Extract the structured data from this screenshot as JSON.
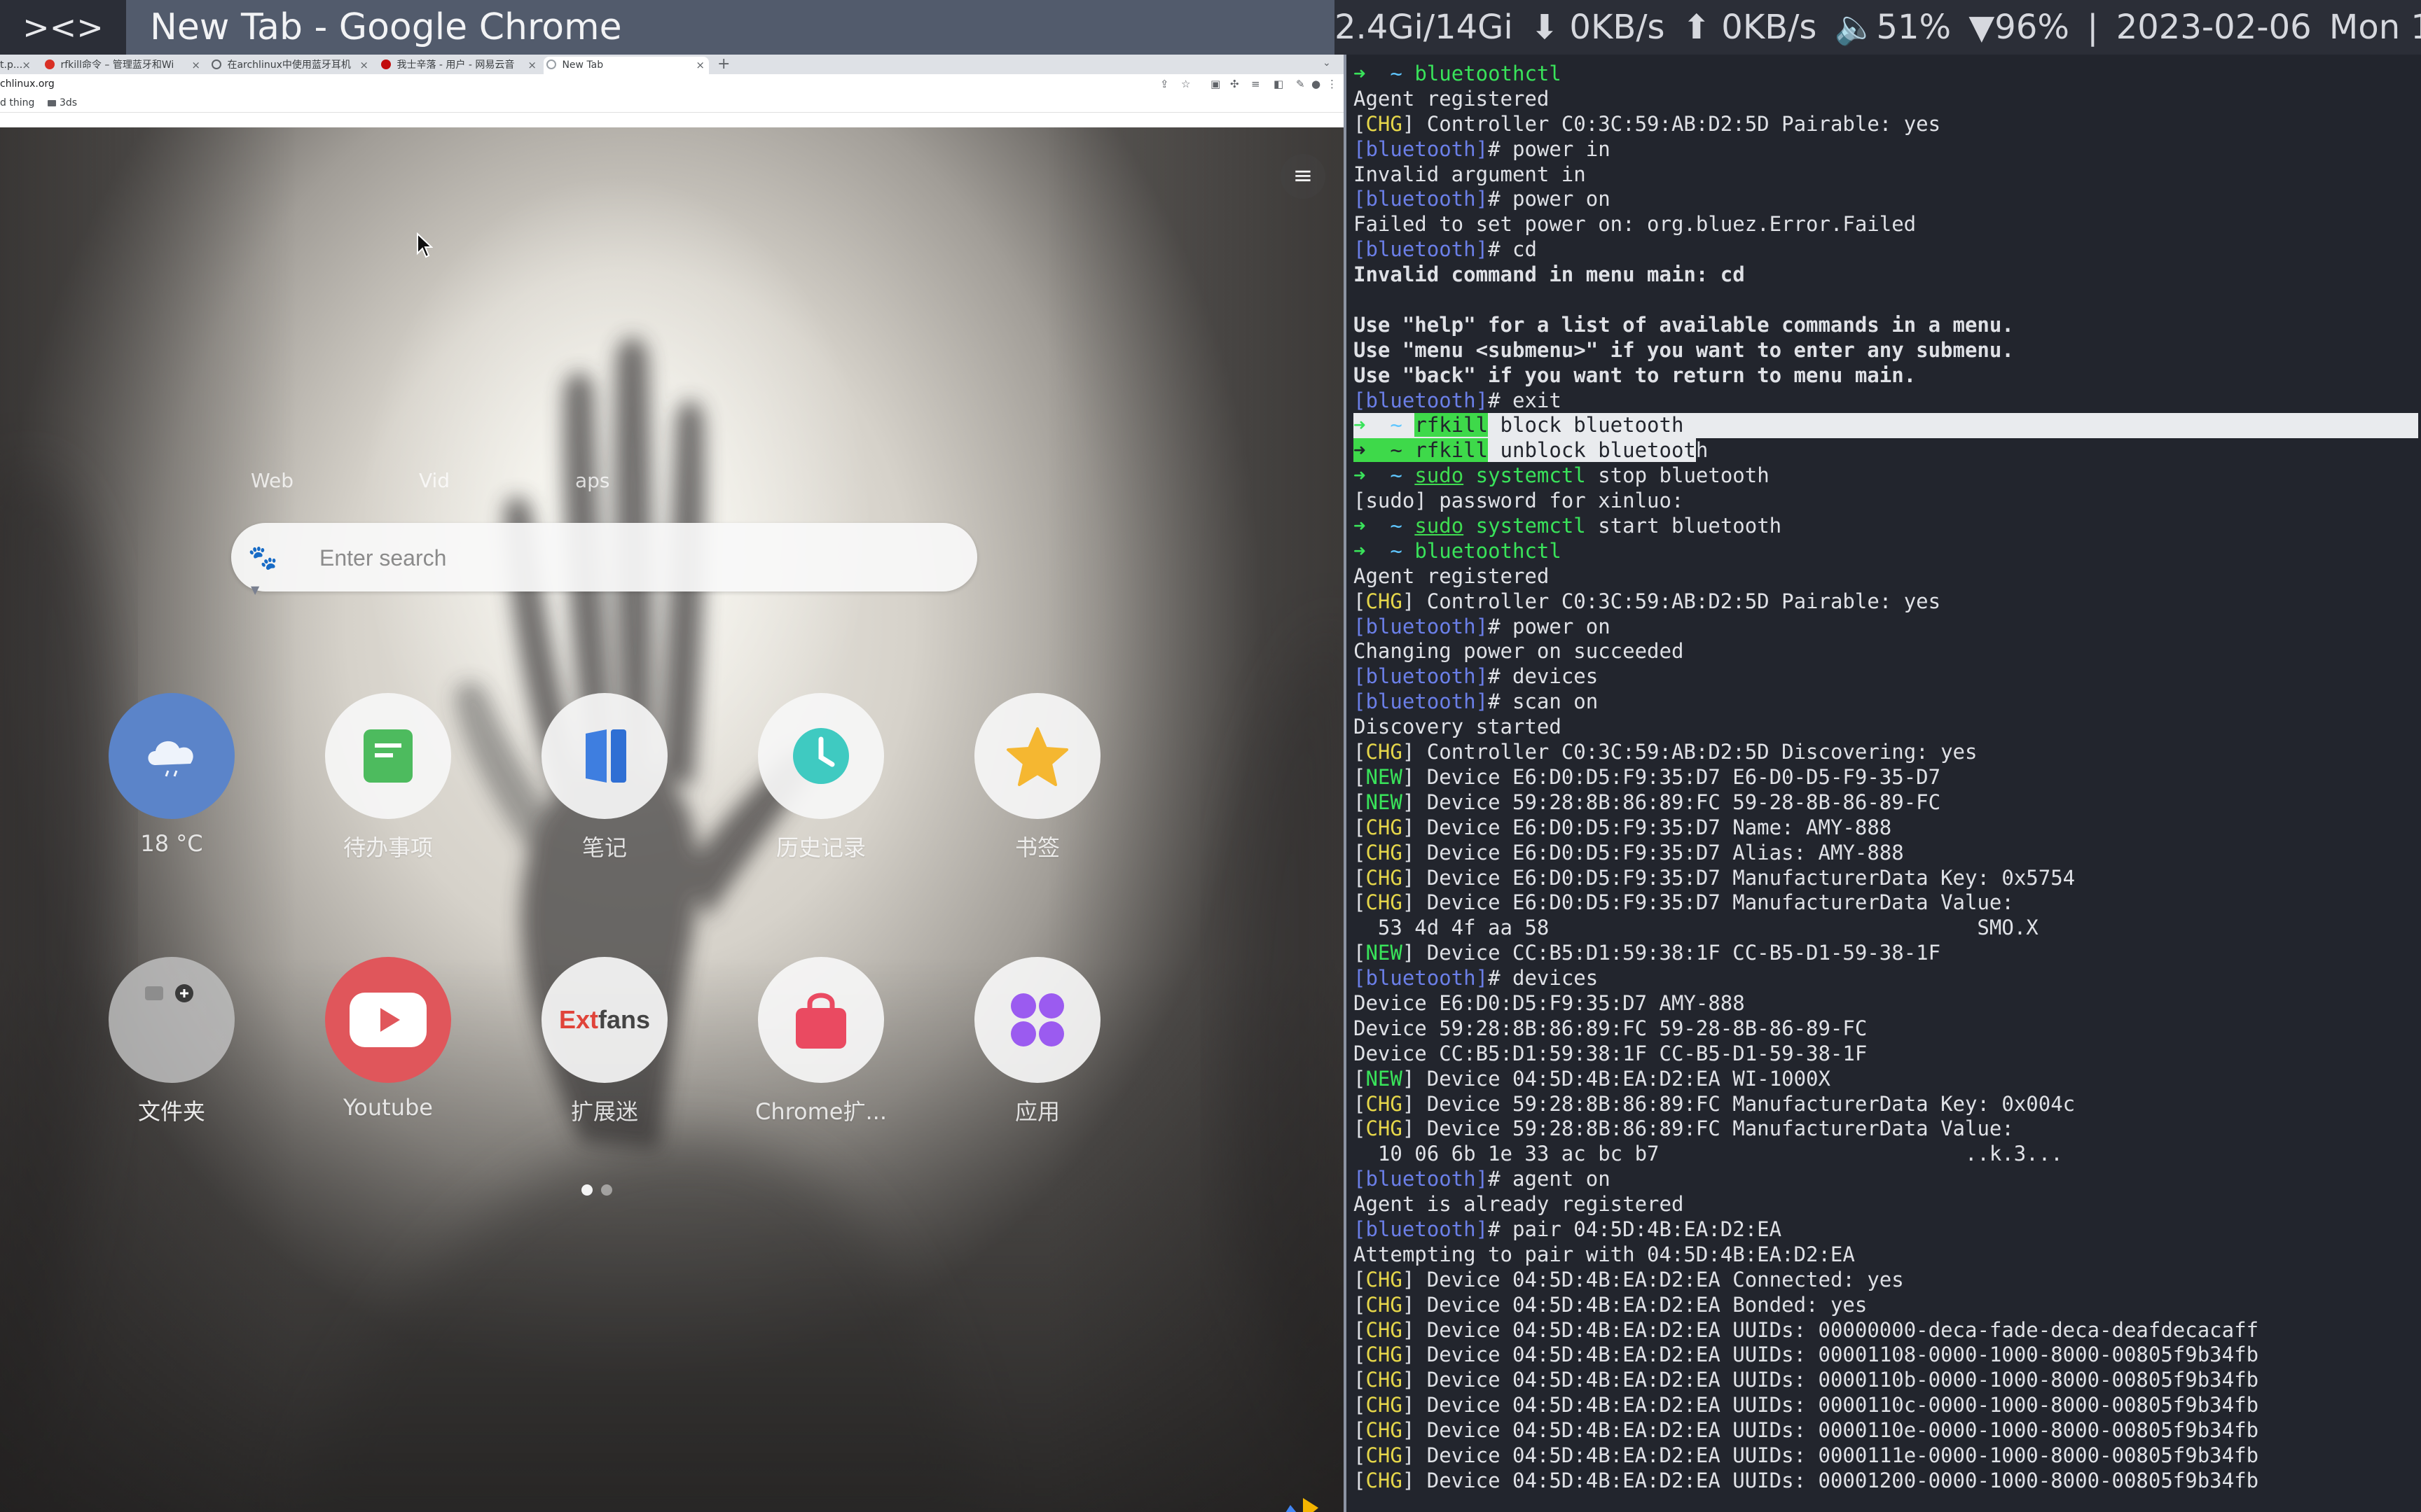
{
  "topbar": {
    "wm_logo": "><>",
    "window_title": "New Tab - Google Chrome",
    "memory": "2.4Gi/14Gi",
    "net_down": "⬇ 0KB/s",
    "net_up": "⬆ 0KB/s",
    "volume": "🔈51%",
    "battery": "▼96%",
    "separator": "|",
    "date": "2023-02-06",
    "day": "Mon 1"
  },
  "chrome": {
    "tabs": [
      {
        "label": "t.p...",
        "icon_color": "#5f6368"
      },
      {
        "label": "rfkill命令 – 管理蓝牙和Wi",
        "icon_color": "#d93025"
      },
      {
        "label": "在archlinux中使用蓝牙耳机",
        "icon_color": "#5f6368"
      },
      {
        "label": "我士辛落 - 用户 - 网易云音",
        "icon_color": "#c20c0c"
      },
      {
        "label": "New Tab",
        "icon_color": "#9aa0a6"
      }
    ],
    "url": "chlinux.org",
    "bookmarks": [
      "d thing",
      "3ds"
    ]
  },
  "ntp": {
    "search_tabs": [
      "Web",
      "Vid",
      "aps"
    ],
    "search_placeholder": "Enter search",
    "apps": [
      {
        "label": "18 °C",
        "icon": "cloud-rain-icon",
        "bg": "#5b84c9"
      },
      {
        "label": "待办事项",
        "icon": "note-icon",
        "bg": "#f3f3f3"
      },
      {
        "label": "笔记",
        "icon": "notebook-icon",
        "bg": "#f3f3f3"
      },
      {
        "label": "历史记录",
        "icon": "clock-icon",
        "bg": "#f3f3f3"
      },
      {
        "label": "书签",
        "icon": "star-icon",
        "bg": "#f3f3f3"
      },
      {
        "label": "文件夹",
        "icon": "folder-group-icon",
        "bg": "#bdbdbd"
      },
      {
        "label": "Youtube",
        "icon": "youtube-icon",
        "bg": "#e0565b"
      },
      {
        "label": "扩展迷",
        "icon": "extfans-icon",
        "bg": "#f3f3f3"
      },
      {
        "label": "Chrome扩...",
        "icon": "bag-icon",
        "bg": "#f3f3f3"
      },
      {
        "label": "应用",
        "icon": "apps-icon",
        "bg": "#f3f3f3"
      }
    ],
    "extfans_text": {
      "ext": "Ext",
      "fans": "fans"
    },
    "pager": {
      "pages": 2,
      "current": 1
    }
  },
  "terminal": {
    "lines": [
      [
        {
          "t": "➜ ",
          "c": "c-green"
        },
        {
          "t": " ~ ",
          "c": "c-cyan"
        },
        {
          "t": "bluetoothctl",
          "c": "c-green"
        }
      ],
      [
        {
          "t": "Agent registered"
        }
      ],
      [
        {
          "t": "["
        },
        {
          "t": "CHG",
          "c": "c-yellow"
        },
        {
          "t": "] Controller C0:3C:59:AB:D2:5D Pairable: yes"
        }
      ],
      [
        {
          "t": "[bluetooth]",
          "c": "c-blue"
        },
        {
          "t": "# power in"
        }
      ],
      [
        {
          "t": "Invalid argument in"
        }
      ],
      [
        {
          "t": "[bluetooth]",
          "c": "c-blue"
        },
        {
          "t": "# power on"
        }
      ],
      [
        {
          "t": "Failed to set power on: org.bluez.Error.Failed"
        }
      ],
      [
        {
          "t": "[bluetooth]",
          "c": "c-blue"
        },
        {
          "t": "# cd"
        }
      ],
      [
        {
          "t": "Invalid command in menu main: cd",
          "c": "c-bold"
        }
      ],
      [
        {
          "t": ""
        }
      ],
      [
        {
          "t": "Use \"help\" for a list of available commands in a menu.",
          "c": "c-bold"
        }
      ],
      [
        {
          "t": "Use \"menu <submenu>\" if you want to enter any submenu.",
          "c": "c-bold"
        }
      ],
      [
        {
          "t": "Use \"back\" if you want to return to menu main.",
          "c": "c-bold"
        }
      ],
      [
        {
          "t": "[bluetooth]",
          "c": "c-blue"
        },
        {
          "t": "# exit"
        }
      ],
      [
        {
          "t": "➜ ",
          "c": "c-green"
        },
        {
          "t": " ~ ",
          "c": "c-cyan"
        },
        {
          "t": "rfkill",
          "c": "hl-green"
        },
        {
          "t": " block bluetooth",
          "c": "hl-line"
        }
      ],
      [
        {
          "t": "➜ ",
          "c": "hl-green"
        },
        {
          "t": " ~ ",
          "c": "hl-green"
        },
        {
          "t": "rfkill",
          "c": "hl-green"
        },
        {
          "t": " unblock bluetoot",
          "c": "hl-line"
        },
        {
          "t": "h"
        }
      ],
      [
        {
          "t": "➜ ",
          "c": "c-green"
        },
        {
          "t": " ~ ",
          "c": "c-cyan"
        },
        {
          "t": "sudo",
          "c": "c-under"
        },
        {
          "t": " "
        },
        {
          "t": "systemctl",
          "c": "c-green"
        },
        {
          "t": " stop bluetooth"
        }
      ],
      [
        {
          "t": "[sudo] password for xinluo:"
        }
      ],
      [
        {
          "t": "➜ ",
          "c": "c-green"
        },
        {
          "t": " ~ ",
          "c": "c-cyan"
        },
        {
          "t": "sudo",
          "c": "c-under"
        },
        {
          "t": " "
        },
        {
          "t": "systemctl",
          "c": "c-green"
        },
        {
          "t": " start bluetooth"
        }
      ],
      [
        {
          "t": "➜ ",
          "c": "c-green"
        },
        {
          "t": " ~ ",
          "c": "c-cyan"
        },
        {
          "t": "bluetoothctl",
          "c": "c-green"
        }
      ],
      [
        {
          "t": "Agent registered"
        }
      ],
      [
        {
          "t": "["
        },
        {
          "t": "CHG",
          "c": "c-yellow"
        },
        {
          "t": "] Controller C0:3C:59:AB:D2:5D Pairable: yes"
        }
      ],
      [
        {
          "t": "[bluetooth]",
          "c": "c-blue"
        },
        {
          "t": "# power on"
        }
      ],
      [
        {
          "t": "Changing power on succeeded"
        }
      ],
      [
        {
          "t": "[bluetooth]",
          "c": "c-blue"
        },
        {
          "t": "# devices"
        }
      ],
      [
        {
          "t": "[bluetooth]",
          "c": "c-blue"
        },
        {
          "t": "# scan on"
        }
      ],
      [
        {
          "t": "Discovery started"
        }
      ],
      [
        {
          "t": "["
        },
        {
          "t": "CHG",
          "c": "c-yellow"
        },
        {
          "t": "] Controller C0:3C:59:AB:D2:5D Discovering: yes"
        }
      ],
      [
        {
          "t": "["
        },
        {
          "t": "NEW",
          "c": "c-green"
        },
        {
          "t": "] Device E6:D0:D5:F9:35:D7 E6-D0-D5-F9-35-D7"
        }
      ],
      [
        {
          "t": "["
        },
        {
          "t": "NEW",
          "c": "c-green"
        },
        {
          "t": "] Device 59:28:8B:86:89:FC 59-28-8B-86-89-FC"
        }
      ],
      [
        {
          "t": "["
        },
        {
          "t": "CHG",
          "c": "c-yellow"
        },
        {
          "t": "] Device E6:D0:D5:F9:35:D7 Name: AMY-888"
        }
      ],
      [
        {
          "t": "["
        },
        {
          "t": "CHG",
          "c": "c-yellow"
        },
        {
          "t": "] Device E6:D0:D5:F9:35:D7 Alias: AMY-888"
        }
      ],
      [
        {
          "t": "["
        },
        {
          "t": "CHG",
          "c": "c-yellow"
        },
        {
          "t": "] Device E6:D0:D5:F9:35:D7 ManufacturerData Key: 0x5754"
        }
      ],
      [
        {
          "t": "["
        },
        {
          "t": "CHG",
          "c": "c-yellow"
        },
        {
          "t": "] Device E6:D0:D5:F9:35:D7 ManufacturerData Value:"
        }
      ],
      [
        {
          "t": "  53 4d 4f aa 58                                   SMO.X"
        }
      ],
      [
        {
          "t": "["
        },
        {
          "t": "NEW",
          "c": "c-green"
        },
        {
          "t": "] Device CC:B5:D1:59:38:1F CC-B5-D1-59-38-1F"
        }
      ],
      [
        {
          "t": "[bluetooth]",
          "c": "c-blue"
        },
        {
          "t": "# devices"
        }
      ],
      [
        {
          "t": "Device E6:D0:D5:F9:35:D7 AMY-888"
        }
      ],
      [
        {
          "t": "Device 59:28:8B:86:89:FC 59-28-8B-86-89-FC"
        }
      ],
      [
        {
          "t": "Device CC:B5:D1:59:38:1F CC-B5-D1-59-38-1F"
        }
      ],
      [
        {
          "t": "["
        },
        {
          "t": "NEW",
          "c": "c-green"
        },
        {
          "t": "] Device 04:5D:4B:EA:D2:EA WI-1000X"
        }
      ],
      [
        {
          "t": "["
        },
        {
          "t": "CHG",
          "c": "c-yellow"
        },
        {
          "t": "] Device 59:28:8B:86:89:FC ManufacturerData Key: 0x004c"
        }
      ],
      [
        {
          "t": "["
        },
        {
          "t": "CHG",
          "c": "c-yellow"
        },
        {
          "t": "] Device 59:28:8B:86:89:FC ManufacturerData Value:"
        }
      ],
      [
        {
          "t": "  10 06 6b 1e 33 ac bc b7                         ..k.3..."
        }
      ],
      [
        {
          "t": "[bluetooth]",
          "c": "c-blue"
        },
        {
          "t": "# agent on"
        }
      ],
      [
        {
          "t": "Agent is already registered"
        }
      ],
      [
        {
          "t": "[bluetooth]",
          "c": "c-blue"
        },
        {
          "t": "# pair 04:5D:4B:EA:D2:EA"
        }
      ],
      [
        {
          "t": "Attempting to pair with 04:5D:4B:EA:D2:EA"
        }
      ],
      [
        {
          "t": "["
        },
        {
          "t": "CHG",
          "c": "c-yellow"
        },
        {
          "t": "] Device 04:5D:4B:EA:D2:EA Connected: yes"
        }
      ],
      [
        {
          "t": "["
        },
        {
          "t": "CHG",
          "c": "c-yellow"
        },
        {
          "t": "] Device 04:5D:4B:EA:D2:EA Bonded: yes"
        }
      ],
      [
        {
          "t": "["
        },
        {
          "t": "CHG",
          "c": "c-yellow"
        },
        {
          "t": "] Device 04:5D:4B:EA:D2:EA UUIDs: 00000000-deca-fade-deca-deafdecacaff"
        }
      ],
      [
        {
          "t": "["
        },
        {
          "t": "CHG",
          "c": "c-yellow"
        },
        {
          "t": "] Device 04:5D:4B:EA:D2:EA UUIDs: 00001108-0000-1000-8000-00805f9b34fb"
        }
      ],
      [
        {
          "t": "["
        },
        {
          "t": "CHG",
          "c": "c-yellow"
        },
        {
          "t": "] Device 04:5D:4B:EA:D2:EA UUIDs: 0000110b-0000-1000-8000-00805f9b34fb"
        }
      ],
      [
        {
          "t": "["
        },
        {
          "t": "CHG",
          "c": "c-yellow"
        },
        {
          "t": "] Device 04:5D:4B:EA:D2:EA UUIDs: 0000110c-0000-1000-8000-00805f9b34fb"
        }
      ],
      [
        {
          "t": "["
        },
        {
          "t": "CHG",
          "c": "c-yellow"
        },
        {
          "t": "] Device 04:5D:4B:EA:D2:EA UUIDs: 0000110e-0000-1000-8000-00805f9b34fb"
        }
      ],
      [
        {
          "t": "["
        },
        {
          "t": "CHG",
          "c": "c-yellow"
        },
        {
          "t": "] Device 04:5D:4B:EA:D2:EA UUIDs: 0000111e-0000-1000-8000-00805f9b34fb"
        }
      ],
      [
        {
          "t": "["
        },
        {
          "t": "CHG",
          "c": "c-yellow"
        },
        {
          "t": "] Device 04:5D:4B:EA:D2:EA UUIDs: 00001200-0000-1000-8000-00805f9b34fb"
        }
      ]
    ]
  }
}
